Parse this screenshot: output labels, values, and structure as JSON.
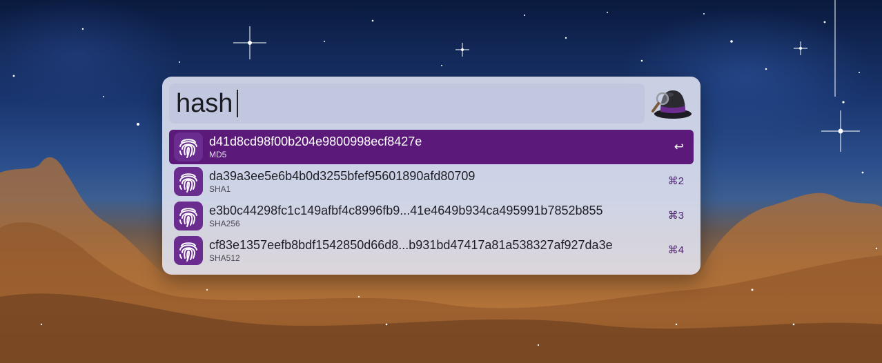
{
  "app": {
    "name": "Alfred",
    "query": "hash",
    "icons": {
      "app": "alfred-hat-icon",
      "result": "fingerprint-icon"
    }
  },
  "results": [
    {
      "title": "d41d8cd98f00b204e9800998ecf8427e",
      "subtitle": "MD5",
      "shortcut": "↩",
      "selected": true
    },
    {
      "title": "da39a3ee5e6b4b0d3255bfef95601890afd80709",
      "subtitle": "SHA1",
      "shortcut": "⌘2",
      "selected": false
    },
    {
      "title": "e3b0c44298fc1c149afbf4c8996fb9...41e4649b934ca495991b7852b855",
      "subtitle": "SHA256",
      "shortcut": "⌘3",
      "selected": false
    },
    {
      "title": "cf83e1357eefb8bdf1542850d66d8...b931bd47417a81a538327af927da3e",
      "subtitle": "SHA512",
      "shortcut": "⌘4",
      "selected": false
    }
  ],
  "colors": {
    "selection": "#5b1a7a",
    "icon_bg": "#6a2d8f",
    "panel": "#e2e5f2",
    "shortcut": "#4e2370"
  }
}
